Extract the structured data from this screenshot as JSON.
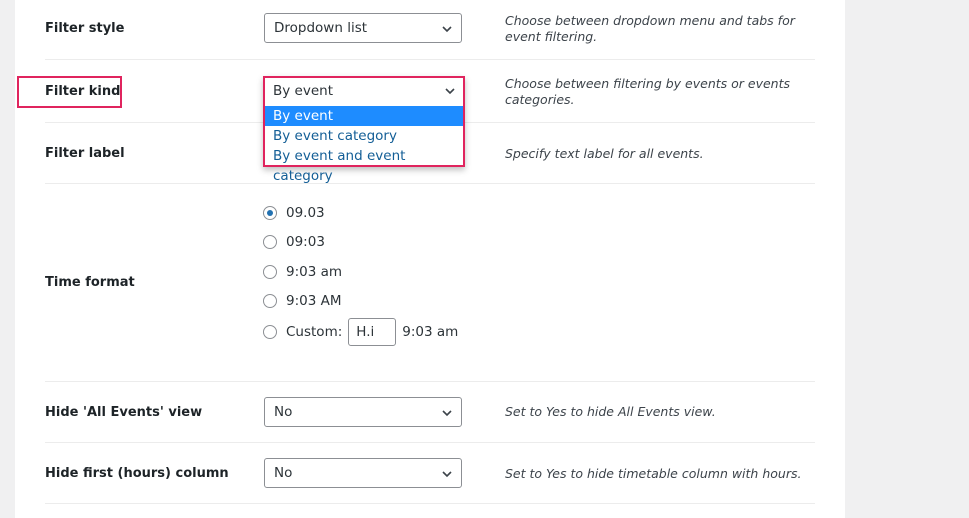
{
  "settings": {
    "filter_style": {
      "label": "Filter style",
      "value": "Dropdown list",
      "description": "Choose between dropdown menu and tabs for event filtering."
    },
    "filter_kind": {
      "label": "Filter kind",
      "value": "By event",
      "options": [
        "By event",
        "By event category",
        "By event and event category"
      ],
      "selected_index": 0,
      "description": "Choose between filtering by events or events categories."
    },
    "filter_label": {
      "label": "Filter label",
      "description": "Specify text label for all events."
    },
    "time_format": {
      "label": "Time format",
      "options": [
        "09.03",
        "09:03",
        "9:03 am",
        "9:03 AM"
      ],
      "selected_index": 0,
      "custom_label": "Custom:",
      "custom_value": "H.i",
      "custom_preview": "9:03 am"
    },
    "hide_all_events": {
      "label": "Hide 'All Events' view",
      "value": "No",
      "description": "Set to Yes to hide All Events view."
    },
    "hide_hours_column": {
      "label": "Hide first (hours) column",
      "value": "No",
      "description": "Set to Yes to hide timetable column with hours."
    }
  },
  "colors": {
    "highlight": "#e0245e",
    "selected_option": "#1e8cff",
    "radio_checked": "#2271b1"
  }
}
